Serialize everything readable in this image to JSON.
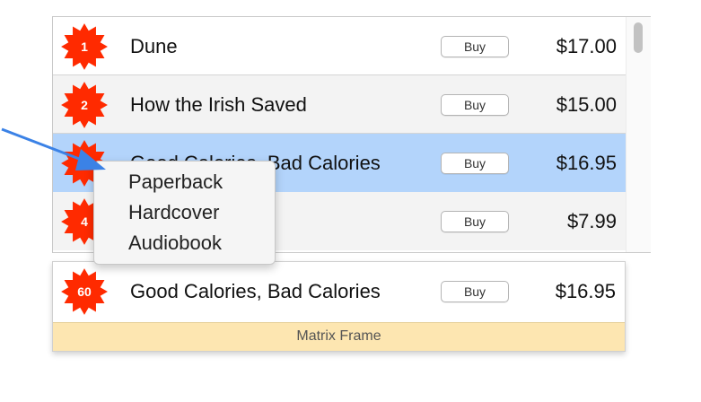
{
  "rows": [
    {
      "rank": "1",
      "title": "Dune",
      "buy_label": "Buy",
      "price": "$17.00"
    },
    {
      "rank": "2",
      "title": "How the Irish Saved",
      "buy_label": "Buy",
      "price": "$15.00"
    },
    {
      "rank": "3",
      "title": "Good Calories, Bad Calories",
      "buy_label": "Buy",
      "price": "$16.95",
      "selected": true
    },
    {
      "rank": "4",
      "title": "",
      "buy_label": "Buy",
      "price": "$7.99"
    }
  ],
  "matrix_frame": {
    "row": {
      "rank": "60",
      "title": "Good Calories, Bad Calories",
      "buy_label": "Buy",
      "price": "$16.95"
    },
    "footer_label": "Matrix Frame"
  },
  "popup_menu": {
    "items": [
      "Paperback",
      "Hardcover",
      "Audiobook"
    ]
  },
  "colors": {
    "badge": "#ff2a00",
    "selected_row": "#b3d4fb",
    "frame_footer": "#fde6b1",
    "arrow": "#3b82e6"
  },
  "icons": {
    "badge": "starburst-badge-icon",
    "pointer": "arrow-pointer-icon"
  }
}
